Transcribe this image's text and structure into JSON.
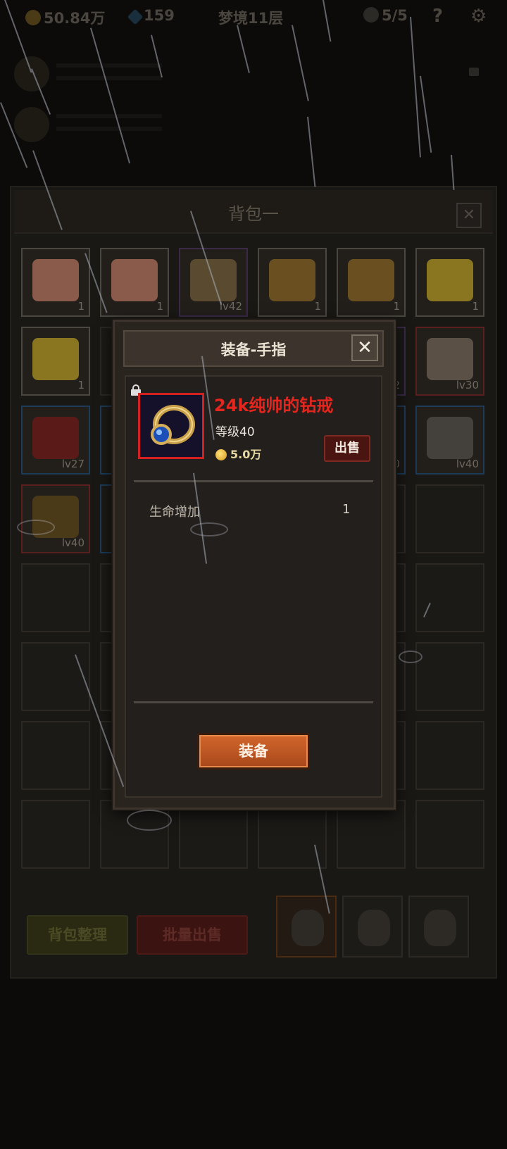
{
  "hud": {
    "coins": "50.84万",
    "gems": "159",
    "floor": "梦境11层",
    "skulls": "5/5",
    "help": "?"
  },
  "bag": {
    "title": "背包一",
    "close": "✕",
    "cells": [
      {
        "label": "1",
        "icon": "cake-icon",
        "color": "#8a5a4a"
      },
      {
        "label": "1",
        "icon": "cake-icon",
        "color": "#8a5a4a"
      },
      {
        "label": "lv42",
        "icon": "sword-icon",
        "color": "#5a4a30",
        "quality": "purple"
      },
      {
        "label": "1",
        "icon": "beer-mug-icon",
        "color": "#6a5020"
      },
      {
        "label": "1",
        "icon": "beer-mug-icon",
        "color": "#6a5020"
      },
      {
        "label": "1",
        "icon": "cheese-icon",
        "color": "#8a7520"
      },
      {
        "label": "1",
        "icon": "cheese-icon",
        "color": "#8a7520"
      },
      {
        "label": "",
        "icon": "",
        "color": ""
      },
      {
        "label": "",
        "icon": "",
        "color": ""
      },
      {
        "label": "",
        "icon": "",
        "color": ""
      },
      {
        "label": "2",
        "icon": "",
        "color": "",
        "quality": "purple"
      },
      {
        "label": "lv30",
        "icon": "shield-icon",
        "color": "#5a5046",
        "quality": "red"
      },
      {
        "label": "lv27",
        "icon": "armor-icon",
        "color": "#5a1a18",
        "quality": "blue"
      },
      {
        "label": "",
        "icon": "",
        "color": "",
        "quality": "blue"
      },
      {
        "label": "",
        "icon": "",
        "color": ""
      },
      {
        "label": "",
        "icon": "",
        "color": ""
      },
      {
        "label": "0",
        "icon": "",
        "color": "",
        "quality": "blue"
      },
      {
        "label": "lv40",
        "icon": "gun-icon",
        "color": "#44403c",
        "quality": "blue"
      },
      {
        "label": "lv40",
        "icon": "ring-icon",
        "color": "#4a3a18",
        "quality": "red"
      },
      {
        "label": "",
        "icon": "",
        "color": "",
        "quality": "blue"
      }
    ],
    "sort_label": "背包整理",
    "bulk_sell_label": "批量出售"
  },
  "modal": {
    "title": "装备-手指",
    "close": "✕",
    "item_name": "24k纯帅的钻戒",
    "item_level": "等级40",
    "item_price": "5.0万",
    "sell_label": "出售",
    "stats": [
      {
        "name": "生命增加",
        "value": "1"
      }
    ],
    "equip_label": "装备"
  },
  "colors": {
    "item_name": "#e4261e",
    "equip_button": "#c25a25",
    "sell_button": "#4a1511"
  }
}
